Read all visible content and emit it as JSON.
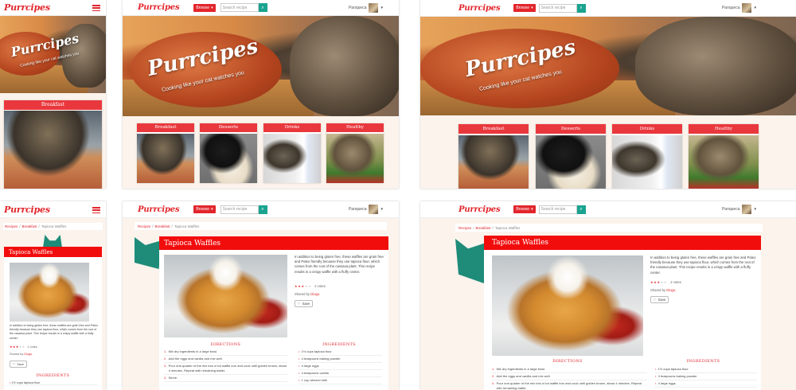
{
  "brand": {
    "name": "Purrcipes",
    "tagline": "Cooking like your cat watches you"
  },
  "nav": {
    "browse_label": "Browse",
    "search_placeholder": "Search recipe",
    "user_name": "Panqueca"
  },
  "categories": [
    {
      "label": "Breakfast"
    },
    {
      "label": "Desserts"
    },
    {
      "label": "Drinks"
    },
    {
      "label": "Healthy"
    }
  ],
  "breadcrumb": {
    "home": "Recipes",
    "category": "Breakfast",
    "current": "Tapioca Waffles"
  },
  "recipe": {
    "title": "Tapioca Waffles",
    "description": "In addition to being gluten free, these waffles are grain free and Paleo friendly because they use tapioca flour, which comes from the root of the cassava plant. This recipe results in a crispy waffle with a fluffy center.",
    "rating": 3.5,
    "stars_on": "★★★",
    "stars_half": "★",
    "stars_off": "★",
    "votes": "2 votes",
    "shared_by_label": "Shared by",
    "shared_by_user": "Diogo.",
    "save_label": "Save",
    "directions_heading": "DIRECTIONS",
    "ingredients_heading": "INGREDIENTS",
    "directions": [
      "Mix dry ingredients in a large bowl.",
      "Add the eggs and vanilla and mix well.",
      "Pour one-quarter of the mix into a hot waffle iron and cook until golden brown, about 4 minutes. Repeat with remaining batter.",
      "Serve."
    ],
    "ingredients": [
      "1½ cups tapioca flour",
      "4 teaspoons baking powder",
      "4 large eggs",
      "4 teaspoons vanilla",
      "1 cup almond milk"
    ],
    "mobile_ingredient_first": "1½ cups tapioca flour"
  },
  "colors": {
    "brand_red": "#e2262c",
    "title_red": "#f20d0d",
    "teal": "#1aa38f",
    "cream": "#fbf3ec"
  }
}
